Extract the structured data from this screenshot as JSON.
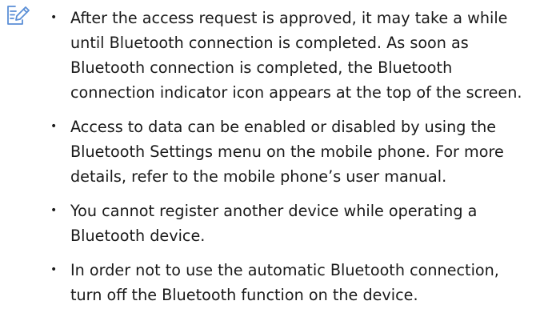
{
  "note": {
    "icon": "note-pencil-icon",
    "accent_color": "#5b8fd6",
    "items": [
      {
        "text": "After the access request is approved, it may take a while until Bluetooth connection is completed. As soon as Bluetooth connection is completed, the Bluetooth connection indicator icon appears at the top of the screen."
      },
      {
        "text": "Access to data can be enabled or disabled by using the Bluetooth Settings menu on the mobile phone. For more details, refer to the mobile phone’s user manual."
      },
      {
        "text": "You cannot register another device while operating a Bluetooth device."
      },
      {
        "text": "In order not to use the automatic Bluetooth connection, turn off the Bluetooth function on the device."
      }
    ]
  }
}
